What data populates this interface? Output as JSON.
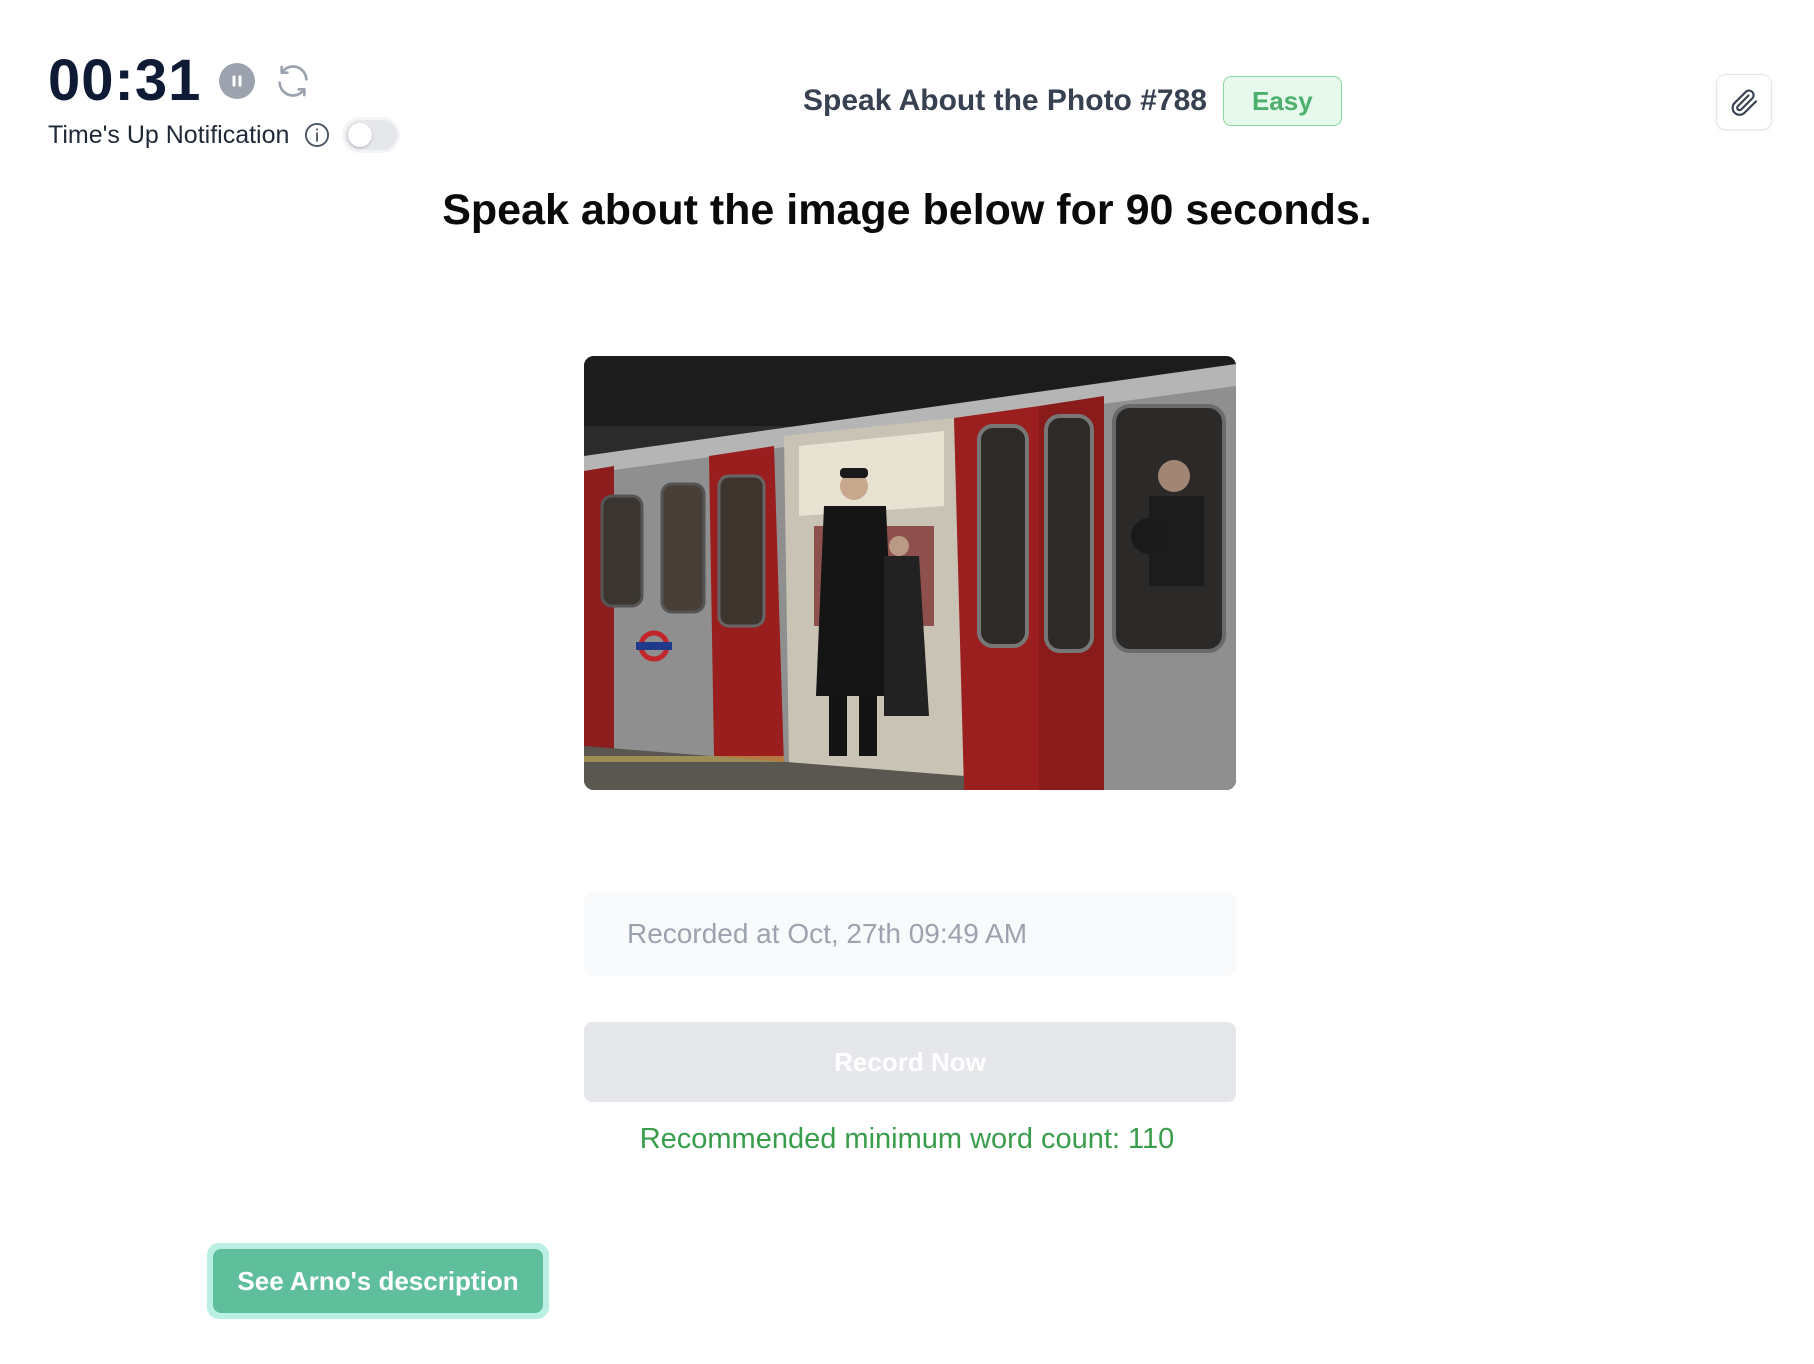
{
  "timer": {
    "value": "00:31",
    "notification_label": "Time's Up Notification",
    "notification_enabled": false
  },
  "task": {
    "title": "Speak About the Photo #788",
    "difficulty": "Easy",
    "instruction": "Speak about the image below for 90 seconds."
  },
  "recording": {
    "status_text": "Recorded at Oct, 27th 09:49 AM",
    "record_button_label": "Record Now",
    "word_count_hint": "Recommended minimum word count: 110"
  },
  "actions": {
    "see_description_label": "See Arno's description"
  },
  "icons": {
    "pause": "pause-icon",
    "refresh": "refresh-icon",
    "info": "info-icon",
    "attachment": "paperclip-icon"
  },
  "colors": {
    "timer_text": "#0f1b35",
    "difficulty_text": "#4caf6e",
    "difficulty_bg": "#e7f8ec",
    "word_count_text": "#3a9d4b",
    "description_button": "#5fbf9c",
    "record_button_disabled": "#e5e7eb"
  }
}
